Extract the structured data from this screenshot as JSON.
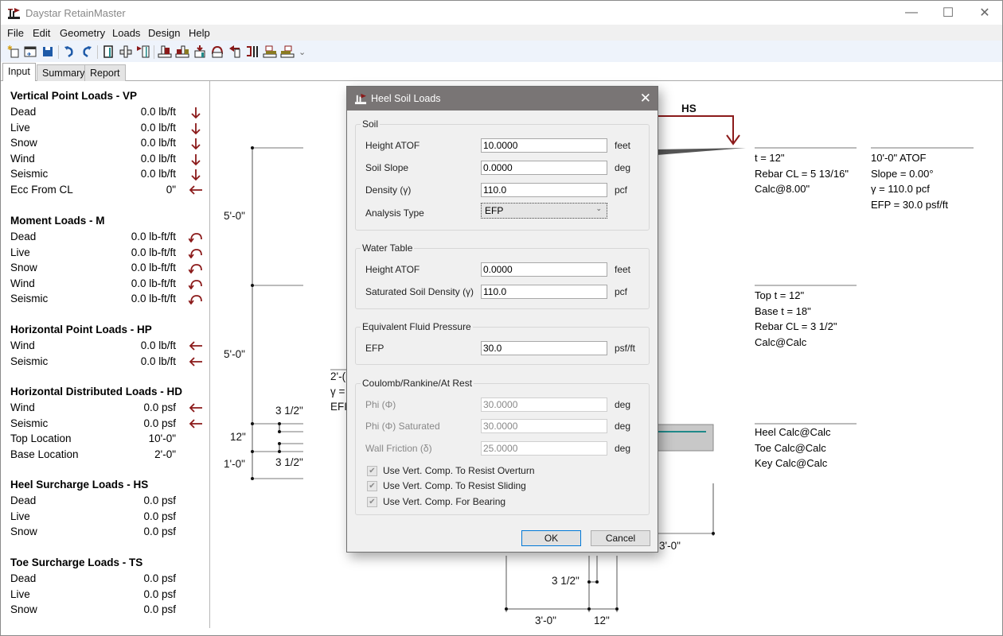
{
  "window": {
    "title": "Daystar RetainMaster",
    "controls": {
      "minimize": "—",
      "maximize": "☐",
      "close": "✕"
    }
  },
  "menu": [
    "File",
    "Edit",
    "Geometry",
    "Loads",
    "Design",
    "Help"
  ],
  "toolbar": {
    "icons": [
      "new-file-icon",
      "open-file-icon",
      "save-icon",
      "undo-icon",
      "redo-icon",
      "wall-stem-icon",
      "footing-icon",
      "vertical-point-load-icon",
      "heel-soil-load-icon",
      "toe-soil-load-icon",
      "surcharge-icon",
      "arch-load-icon",
      "horizontal-point-load-icon",
      "moment-load-icon",
      "heel-surcharge-icon",
      "toe-surcharge-icon"
    ],
    "overflow": "⌄"
  },
  "tabs": [
    {
      "label": "Input",
      "active": true
    },
    {
      "label": "Summary",
      "active": false
    },
    {
      "label": "Report",
      "active": false
    }
  ],
  "panel": {
    "groups": [
      {
        "title": "Vertical Point Loads - VP",
        "rows": [
          {
            "label": "Dead",
            "value": "0.0 lb/ft",
            "icon": "down-arrow"
          },
          {
            "label": "Live",
            "value": "0.0 lb/ft",
            "icon": "down-arrow"
          },
          {
            "label": "Snow",
            "value": "0.0 lb/ft",
            "icon": "down-arrow"
          },
          {
            "label": "Wind",
            "value": "0.0 lb/ft",
            "icon": "down-arrow"
          },
          {
            "label": "Seismic",
            "value": "0.0 lb/ft",
            "icon": "down-arrow"
          },
          {
            "label": "Ecc From CL",
            "value": "0\"",
            "icon": "left-arrow"
          }
        ]
      },
      {
        "title": "Moment Loads - M",
        "rows": [
          {
            "label": "Dead",
            "value": "0.0 lb-ft/ft",
            "icon": "moment"
          },
          {
            "label": "Live",
            "value": "0.0 lb-ft/ft",
            "icon": "moment"
          },
          {
            "label": "Snow",
            "value": "0.0 lb-ft/ft",
            "icon": "moment"
          },
          {
            "label": "Wind",
            "value": "0.0 lb-ft/ft",
            "icon": "moment"
          },
          {
            "label": "Seismic",
            "value": "0.0 lb-ft/ft",
            "icon": "moment"
          }
        ]
      },
      {
        "title": "Horizontal Point Loads - HP",
        "rows": [
          {
            "label": "Wind",
            "value": "0.0 lb/ft",
            "icon": "left-arrow"
          },
          {
            "label": "Seismic",
            "value": "0.0 lb/ft",
            "icon": "left-arrow"
          }
        ]
      },
      {
        "title": "Horizontal Distributed Loads - HD",
        "rows": [
          {
            "label": "Wind",
            "value": "0.0 psf",
            "icon": "left-arrow"
          },
          {
            "label": "Seismic",
            "value": "0.0 psf",
            "icon": "left-arrow"
          },
          {
            "label": "Top Location",
            "value": "10'-0\"",
            "icon": ""
          },
          {
            "label": "Base Location",
            "value": "2'-0\"",
            "icon": ""
          }
        ]
      },
      {
        "title": "Heel Surcharge Loads - HS",
        "rows": [
          {
            "label": "Dead",
            "value": "0.0 psf",
            "icon": ""
          },
          {
            "label": "Live",
            "value": "0.0 psf",
            "icon": ""
          },
          {
            "label": "Snow",
            "value": "0.0 psf",
            "icon": ""
          }
        ]
      },
      {
        "title": "Toe Surcharge Loads - TS",
        "rows": [
          {
            "label": "Dead",
            "value": "0.0 psf",
            "icon": ""
          },
          {
            "label": "Live",
            "value": "0.0 psf",
            "icon": ""
          },
          {
            "label": "Snow",
            "value": "0.0 psf",
            "icon": ""
          }
        ]
      }
    ]
  },
  "canvas": {
    "dims_left": [
      "5'-0\"",
      "5'-0\"",
      "12\"",
      "1'-0\""
    ],
    "dims_small": [
      "3 1/2\"",
      "3 1/2\""
    ],
    "dims_bottom": [
      "3 1/2\"",
      "3'-0\"",
      "12\"",
      "3'-0\""
    ],
    "hs_label": "HS",
    "partial_left_note": [
      "2'-(",
      "γ =",
      "EFI"
    ],
    "stem_top_note": [
      "t = 12\"",
      "Rebar CL = 5 13/16\"",
      "Calc@8.00\""
    ],
    "soil_note": [
      "10'-0\" ATOF",
      "Slope = 0.00°",
      "γ = 110.0 pcf",
      "EFP = 30.0 psf/ft"
    ],
    "stem_base_note": [
      "Top t = 12\"",
      "Base t = 18\"",
      "Rebar CL = 3 1/2\"",
      "Calc@Calc"
    ],
    "footing_note": [
      "Heel Calc@Calc",
      "Toe Calc@Calc",
      "Key Calc@Calc"
    ],
    "colors": {
      "load_arrow": "#8b1a1a",
      "rebar": "#1f8a8a",
      "footing": "#c8c8c8"
    }
  },
  "dialog": {
    "title": "Heel Soil Loads",
    "close": "✕",
    "soil": {
      "legend": "Soil",
      "height_label": "Height ATOF",
      "height_value": "10.0000",
      "height_unit": "feet",
      "slope_label": "Soil Slope",
      "slope_value": "0.0000",
      "slope_unit": "deg",
      "density_label": "Density (γ)",
      "density_value": "110.0",
      "density_unit": "pcf",
      "analysis_label": "Analysis Type",
      "analysis_value": "EFP"
    },
    "water": {
      "legend": "Water Table",
      "height_label": "Height ATOF",
      "height_value": "0.0000",
      "height_unit": "feet",
      "sat_label": "Saturated Soil Density (γ)",
      "sat_value": "110.0",
      "sat_unit": "pcf"
    },
    "efp": {
      "legend": "Equivalent Fluid Pressure",
      "label": "EFP",
      "value": "30.0",
      "unit": "psf/ft"
    },
    "coulomb": {
      "legend": "Coulomb/Rankine/At Rest",
      "phi_label": "Phi (Φ)",
      "phi_value": "30.0000",
      "phi_unit": "deg",
      "phisat_label": "Phi (Φ) Saturated",
      "phisat_value": "30.0000",
      "phisat_unit": "deg",
      "wf_label": "Wall Friction (δ)",
      "wf_value": "25.0000",
      "wf_unit": "deg",
      "checks": [
        {
          "label": "Use Vert. Comp. To Resist Overturn",
          "checked": true
        },
        {
          "label": "Use Vert. Comp. To Resist Sliding",
          "checked": true
        },
        {
          "label": "Use Vert. Comp. For Bearing",
          "checked": true
        }
      ]
    },
    "ok": "OK",
    "cancel": "Cancel"
  }
}
